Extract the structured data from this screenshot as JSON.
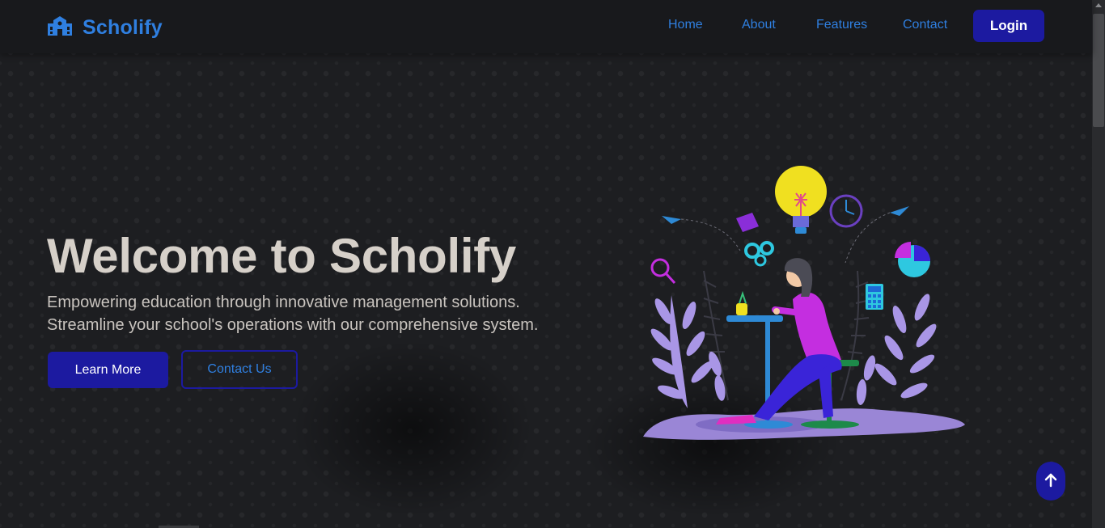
{
  "brand": {
    "name": "Scholify",
    "icon": "school-icon",
    "color": "#2f7fe0"
  },
  "nav": {
    "links": [
      "Home",
      "About",
      "Features",
      "Contact"
    ],
    "login_label": "Login"
  },
  "hero": {
    "title": "Welcome to Scholify",
    "subtitle_line1": "Empowering education through innovative management solutions.",
    "subtitle_line2": "Streamline your school's operations with our comprehensive system.",
    "primary_button": "Learn More",
    "secondary_button": "Contact Us",
    "illustration": "person-studying-at-desk-illustration"
  },
  "scroll_top": {
    "icon": "arrow-up-icon"
  },
  "colors": {
    "accent": "#1c1aa0",
    "link": "#2f7fe0",
    "background": "#1d1e21",
    "title": "#d6d0c9"
  }
}
